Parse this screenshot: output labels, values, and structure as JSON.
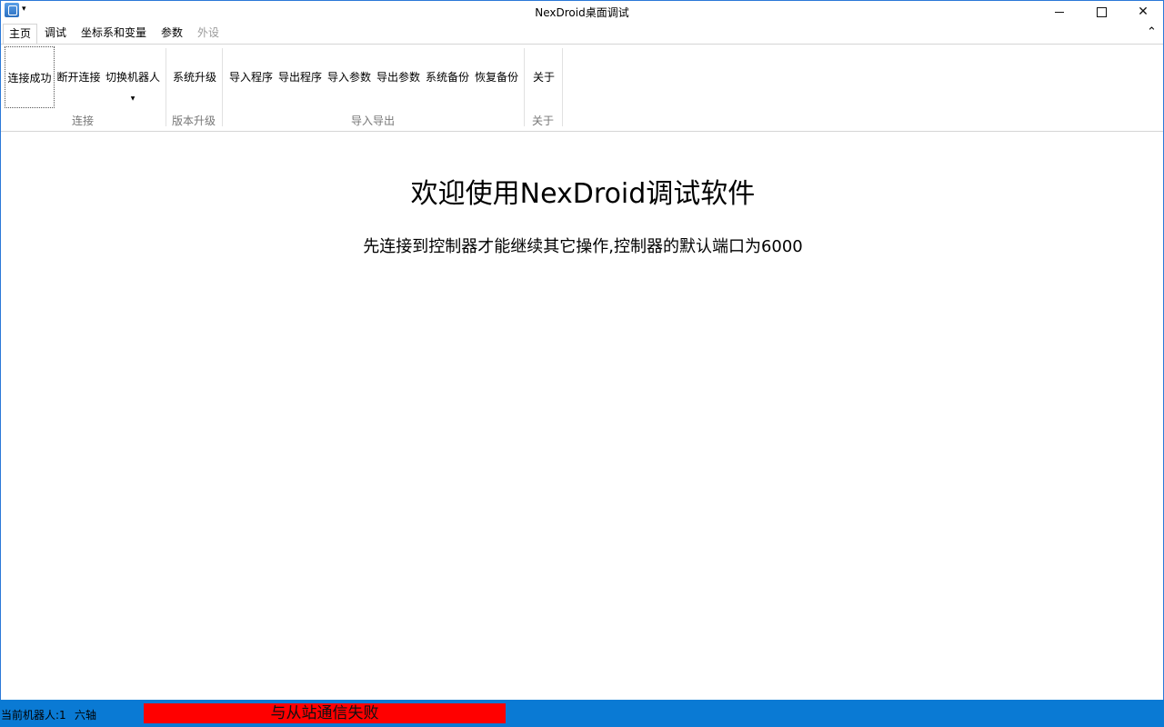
{
  "window": {
    "title": "NexDroid桌面调试",
    "app_icon": "app-icon",
    "controls": {
      "minimize": "minimize-icon",
      "maximize": "maximize-icon",
      "close": "✕"
    }
  },
  "quick_access_arrow": "▾",
  "tabs": [
    {
      "label": "主页",
      "active": true,
      "enabled": true
    },
    {
      "label": "调试",
      "active": false,
      "enabled": true
    },
    {
      "label": "坐标系和变量",
      "active": false,
      "enabled": true
    },
    {
      "label": "参数",
      "active": false,
      "enabled": true
    },
    {
      "label": "外设",
      "active": false,
      "enabled": false
    }
  ],
  "collapse_icon": "⌃",
  "ribbon": {
    "groups": [
      {
        "label": "连接",
        "buttons": [
          "连接成功",
          "断开连接",
          "切换机器人"
        ]
      },
      {
        "label": "版本升级",
        "buttons": [
          "系统升级"
        ]
      },
      {
        "label": "导入导出",
        "buttons": [
          "导入程序",
          "导出程序",
          "导入参数",
          "导出参数",
          "系统备份",
          "恢复备份"
        ]
      },
      {
        "label": "关于",
        "buttons": [
          "关于"
        ]
      }
    ],
    "dropdown_arrow": "▼"
  },
  "main": {
    "title": "欢迎使用NexDroid调试软件",
    "subtitle": "先连接到控制器才能继续其它操作,控制器的默认端口为6000"
  },
  "status": {
    "robot": "当前机器人:1",
    "axis": "六轴",
    "error": "与从站通信失败",
    "colors": {
      "bar": "#0a7ad4",
      "error_bg": "#ff0000"
    }
  }
}
